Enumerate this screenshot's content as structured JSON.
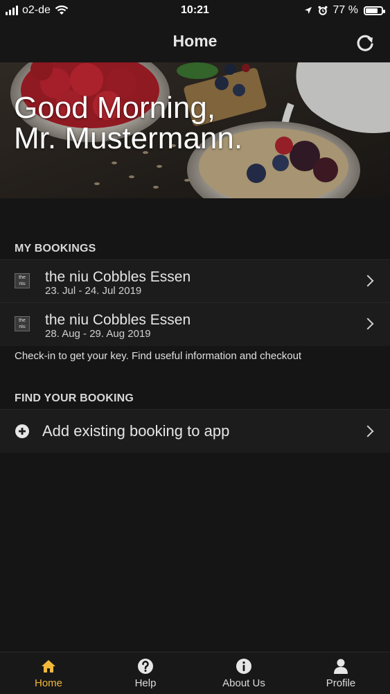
{
  "status_bar": {
    "carrier": "o2-de",
    "time": "10:21",
    "battery_percent": "77 %",
    "battery_level": 0.77
  },
  "nav": {
    "title": "Home",
    "refresh_icon": "refresh-icon"
  },
  "hero": {
    "greeting_line1": "Good Morning,",
    "greeting_line2": "Mr. Mustermann."
  },
  "my_bookings": {
    "header": "MY BOOKINGS",
    "items": [
      {
        "logo_top": "the",
        "logo_bottom": "niu",
        "name": "the niu Cobbles Essen",
        "dates": "23. Jul - 24. Jul 2019"
      },
      {
        "logo_top": "the",
        "logo_bottom": "niu",
        "name": "the niu Cobbles Essen",
        "dates": "28. Aug - 29. Aug 2019"
      }
    ],
    "note": "Check-in to get your key. Find useful information and checkout"
  },
  "find_booking": {
    "header": "FIND YOUR BOOKING",
    "add_label": "Add existing booking to app"
  },
  "tabbar": {
    "items": [
      {
        "label": "Home",
        "icon": "home-icon",
        "active": true
      },
      {
        "label": "Help",
        "icon": "help-icon",
        "active": false
      },
      {
        "label": "About Us",
        "icon": "info-icon",
        "active": false
      },
      {
        "label": "Profile",
        "icon": "profile-icon",
        "active": false
      }
    ]
  },
  "colors": {
    "accent": "#f0b93b",
    "background": "#151515",
    "row": "#1c1c1c"
  }
}
